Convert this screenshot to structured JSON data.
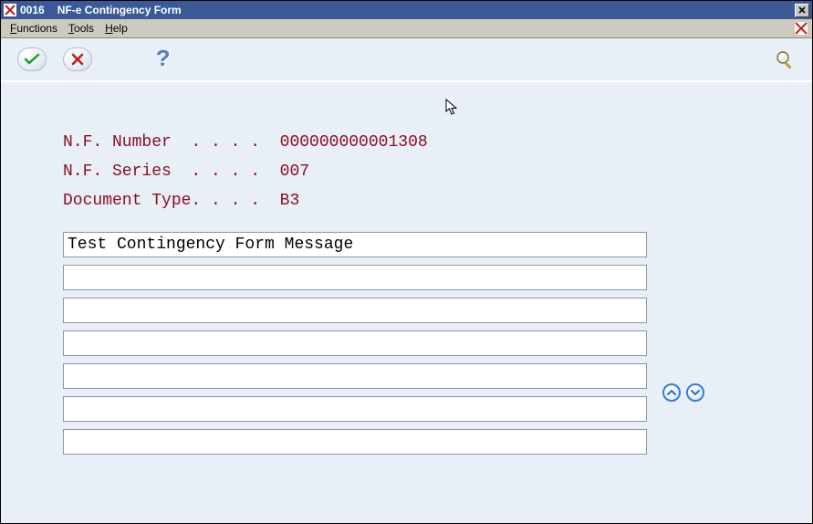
{
  "titlebar": {
    "code": "0016",
    "title": "NF-e Contingency Form"
  },
  "menubar": {
    "functions": "Functions",
    "tools": "Tools",
    "help": "Help"
  },
  "info": {
    "nf_number_label": "N.F. Number  . . . .  ",
    "nf_number_value": "000000000001308",
    "nf_series_label": "N.F. Series  . . . .  ",
    "nf_series_value": "007",
    "doctype_label": "Document Type. . . .  ",
    "doctype_value": "B3"
  },
  "messages": [
    "Test Contingency Form Message",
    "",
    "",
    "",
    "",
    "",
    ""
  ]
}
